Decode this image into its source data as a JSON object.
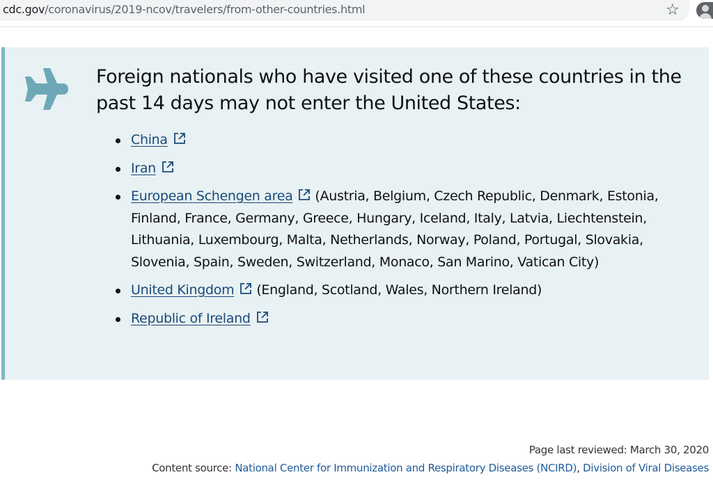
{
  "browser": {
    "url_domain": "cdc.gov",
    "url_path": "/coronavirus/2019-ncov/travelers/from-other-countries.html",
    "bookmark_icon": "star-icon",
    "profile_icon": "profile-icon"
  },
  "callout": {
    "icon": "airplane-icon",
    "icon_color": "#6ea8b8",
    "background_color": "#e8f1f3",
    "heading": "Foreign nationals who have visited one of these countries in the past 14 days may not enter the United States:",
    "items": [
      {
        "link": "China",
        "detail": ""
      },
      {
        "link": "Iran",
        "detail": ""
      },
      {
        "link": "European Schengen area",
        "detail": "(Austria, Belgium, Czech Republic, Denmark, Estonia, Finland, France, Germany, Greece, Hungary, Iceland, Italy, Latvia, Liechtenstein, Lithuania, Luxembourg, Malta, Netherlands, Norway, Poland, Portugal, Slovakia, Slovenia, Spain, Sweden, Switzerland, Monaco, San Marino, Vatican City)"
      },
      {
        "link": "United Kingdom",
        "detail": "(England, Scotland, Wales, Northern Ireland)"
      },
      {
        "link": "Republic of Ireland",
        "detail": ""
      }
    ],
    "link_color": "#1a4a7a"
  },
  "footer": {
    "reviewed": "Page last reviewed: March 30, 2020",
    "source_prefix": "Content source: ",
    "source_link1": "National Center for Immunization and Respiratory Diseases (NCIRD)",
    "source_sep": ", ",
    "source_link2": "Division of Viral Diseases"
  }
}
